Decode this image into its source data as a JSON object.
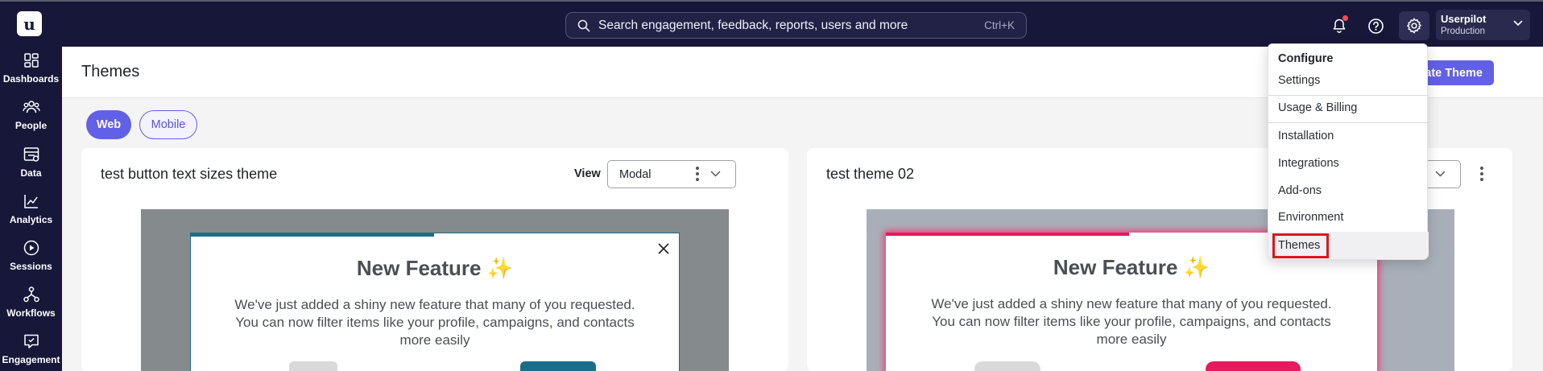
{
  "topbar": {
    "logo_letter": "u",
    "search_placeholder": "Search engagement, feedback, reports, users and more",
    "search_shortcut": "Ctrl+K",
    "account_name": "Userpilot",
    "account_env": "Production",
    "icons": [
      "search-icon",
      "bell-icon",
      "help-icon",
      "gear-icon",
      "chevron-down-icon"
    ],
    "notification_dot_color": "#ff4a4a"
  },
  "sidebar": {
    "items": [
      {
        "label": "Dashboards",
        "icon": "dashboard-icon"
      },
      {
        "label": "People",
        "icon": "people-icon"
      },
      {
        "label": "Data",
        "icon": "data-icon"
      },
      {
        "label": "Analytics",
        "icon": "analytics-icon"
      },
      {
        "label": "Sessions",
        "icon": "sessions-icon"
      },
      {
        "label": "Workflows",
        "icon": "workflows-icon"
      },
      {
        "label": "Engagement",
        "icon": "engagement-icon"
      }
    ]
  },
  "header": {
    "title": "Themes",
    "create_button": "reate Theme"
  },
  "platform_tabs": {
    "web": "Web",
    "mobile": "Mobile",
    "active": "Web"
  },
  "cards": [
    {
      "title": "test button text sizes theme",
      "view_label": "View",
      "view_value": "Modal",
      "preview": {
        "title": "New Feature",
        "sparkle": "✨",
        "body": "We've just added a shiny new feature that many of you requested. You can now filter items like your profile, campaigns, and contacts more easily",
        "accent_color": "#1b6e8a"
      }
    },
    {
      "title": "test theme 02",
      "preview": {
        "title": "New Feature",
        "sparkle": "✨",
        "body": "We've just added a shiny new feature that many of you requested. You can now filter items like your profile, campaigns, and contacts more easily",
        "accent_color": "#e8195d"
      }
    }
  ],
  "configure_menu": {
    "header": "Configure",
    "items": [
      "Settings",
      "Usage & Billing",
      "Installation",
      "Integrations",
      "Add-ons",
      "Environment",
      "Themes"
    ],
    "highlighted": "Themes",
    "highlight_color": "#e0141e"
  },
  "colors": {
    "nav_bg": "#17173a",
    "primary": "#6260e6"
  }
}
